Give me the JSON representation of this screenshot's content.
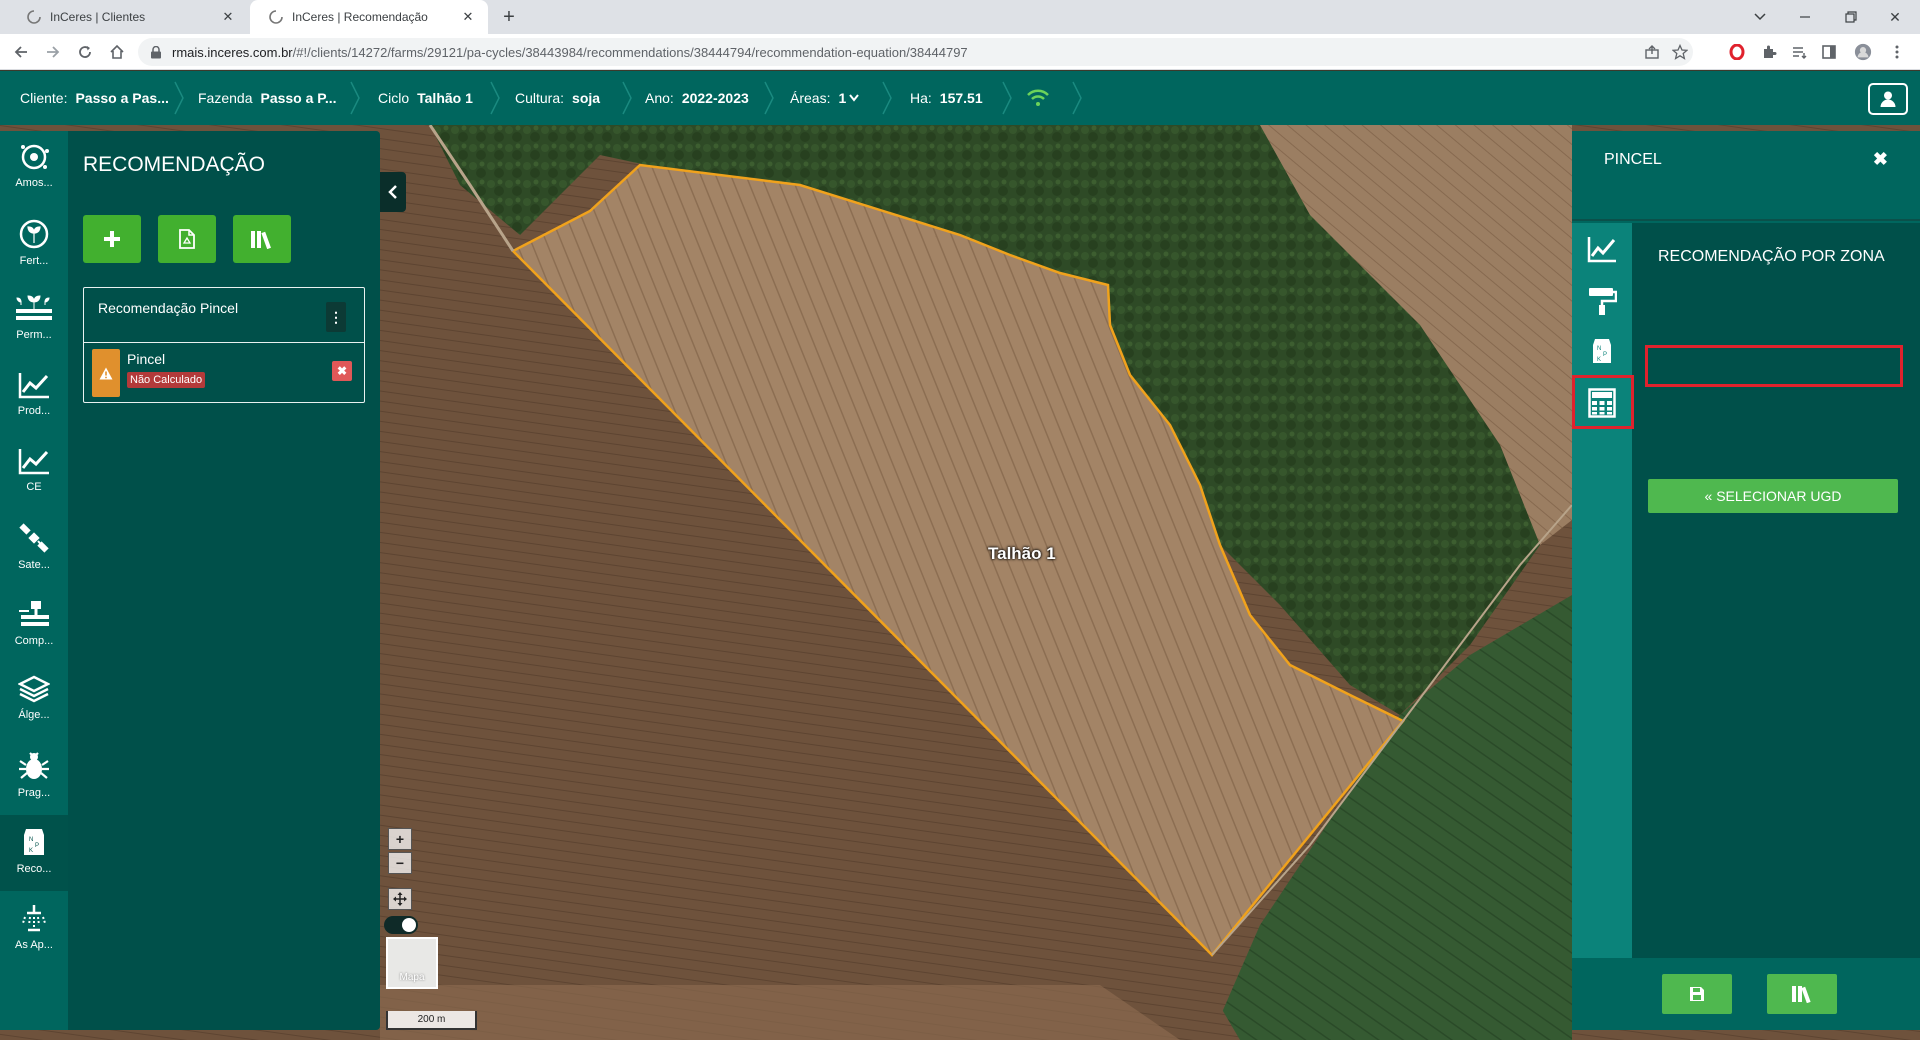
{
  "browser": {
    "tabs": [
      {
        "title": "InCeres | Clientes",
        "active": false
      },
      {
        "title": "InCeres | Recomendação",
        "active": true
      }
    ],
    "url_host": "rmais.inceres.com.br",
    "url_path": "/#!/clients/14272/farms/29121/pa-cycles/38443984/recommendations/38444794/recommendation-equation/38444797"
  },
  "header": {
    "crumbs": [
      {
        "label": "Cliente:",
        "value": "Passo a Pas..."
      },
      {
        "label": "Fazenda",
        "value": "Passo a P..."
      },
      {
        "label": "Ciclo",
        "value": "Talhão 1"
      },
      {
        "label": "Cultura:",
        "value": "soja"
      },
      {
        "label": "Ano:",
        "value": "2022-2023"
      },
      {
        "label": "Áreas:",
        "value": "1"
      },
      {
        "label": "Ha:",
        "value": "157.51"
      }
    ],
    "status_icon": "wifi-icon",
    "user_icon": "user-icon"
  },
  "rail": {
    "items": [
      {
        "label": "Amos...",
        "icon": "sampling-icon"
      },
      {
        "label": "Fert...",
        "icon": "fertility-icon"
      },
      {
        "label": "Perm...",
        "icon": "permeability-icon"
      },
      {
        "label": "Prod...",
        "icon": "productivity-chart-icon"
      },
      {
        "label": "CE",
        "icon": "ce-chart-icon"
      },
      {
        "label": "Sate...",
        "icon": "satellite-icon"
      },
      {
        "label": "Comp...",
        "icon": "compaction-icon"
      },
      {
        "label": "Álge...",
        "icon": "layers-icon"
      },
      {
        "label": "Prag...",
        "icon": "bug-icon"
      },
      {
        "label": "Reco...",
        "icon": "fertilizer-bag-icon"
      },
      {
        "label": "As Ap...",
        "icon": "sprayer-icon"
      }
    ],
    "active_index": 9
  },
  "left_panel": {
    "title": "RECOMENDAÇÃO",
    "card": {
      "name": "Recomendação Pincel",
      "item_name": "Pincel",
      "status": "Não Calculado"
    }
  },
  "map": {
    "field_label": "Talhão 1",
    "layer_label": "Mapa",
    "scale_label": "200 m",
    "colors": {
      "boundary": "#f0a21c"
    }
  },
  "right_panel": {
    "title": "PINCEL",
    "heading": "RECOMENDAÇÃO POR ZONA",
    "select_button": "« SELECIONAR UGD",
    "side_icons": [
      "chart-line-icon",
      "paint-roller-icon",
      "fertilizer-bag-icon",
      "calculator-icon"
    ],
    "colors": {
      "accent": "#4fb84f",
      "highlight": "#e0222d"
    }
  },
  "colors": {
    "brand": "#00665e",
    "panel": "#00504a",
    "button_green": "#42b02f"
  }
}
